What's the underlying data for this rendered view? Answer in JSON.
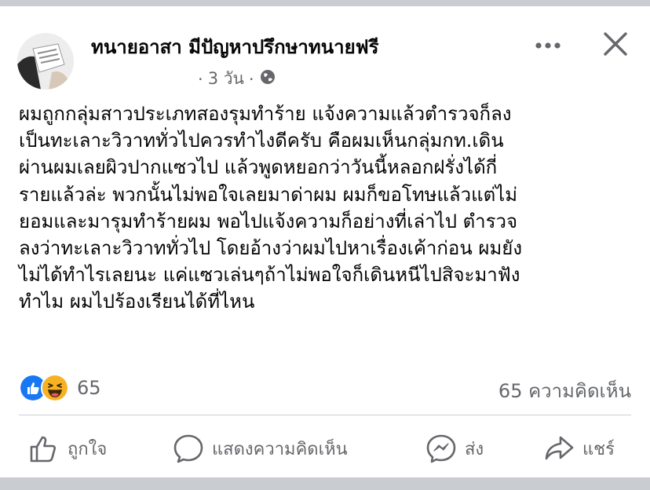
{
  "post": {
    "page_name": "ทนายอาสา มีปัญหาปรึกษาทนายฟรี",
    "meta_prefix": "· ",
    "time": "3 วัน",
    "meta_sep": "·",
    "audience_icon": "globe-icon",
    "text_lines": [
      "ผมถูกกลุ่มสาวประเภทสองรุมทำร้าย แจ้งความแล้วตำรวจก็ลง",
      "เป็นทะเลาะวิวาททั่วไปควรทำไงดีครับ คือผมเห็นกลุ่มกท.เดิน",
      "ผ่านผมเลยผิวปากแซวไป แล้วพูดหยอกว่าวันนี้หลอกฝรั่งได้กี่",
      "รายแล้วล่ะ พวกนั้นไม่พอใจเลยมาด่าผม ผมก็ขอโทษแล้วแต่ไม่",
      "ยอมและมารุมทำร้ายผม พอไปแจ้งความก็อย่างที่เล่าไป ตำรวจ",
      "ลงว่าทะเลาะวิวาททั่วไป โดยอ้างว่าผมไปหาเรื่องเค้าก่อน ผมยัง",
      "ไม่ได้ทำไรเลยนะ แค่แซวเล่นๆถ้าไม่พอใจก็เดินหนีไปสิจะมาฟัง",
      "ทำไม ผมไปร้องเรียนได้ที่ไหน"
    ]
  },
  "stats": {
    "reaction_icons": [
      "like-icon",
      "haha-icon"
    ],
    "reaction_count": "65",
    "comment_count": "65 ความคิดเห็น"
  },
  "actions": {
    "like": "ถูกใจ",
    "comment": "แสดงความคิดเห็น",
    "send": "ส่ง",
    "share": "แชร์"
  },
  "colors": {
    "like_blue": "#1877f2",
    "haha_yellow": "#f7b125",
    "secondary_text": "#65676b",
    "divider": "#ced0d4",
    "background": "#c9ccd1"
  }
}
